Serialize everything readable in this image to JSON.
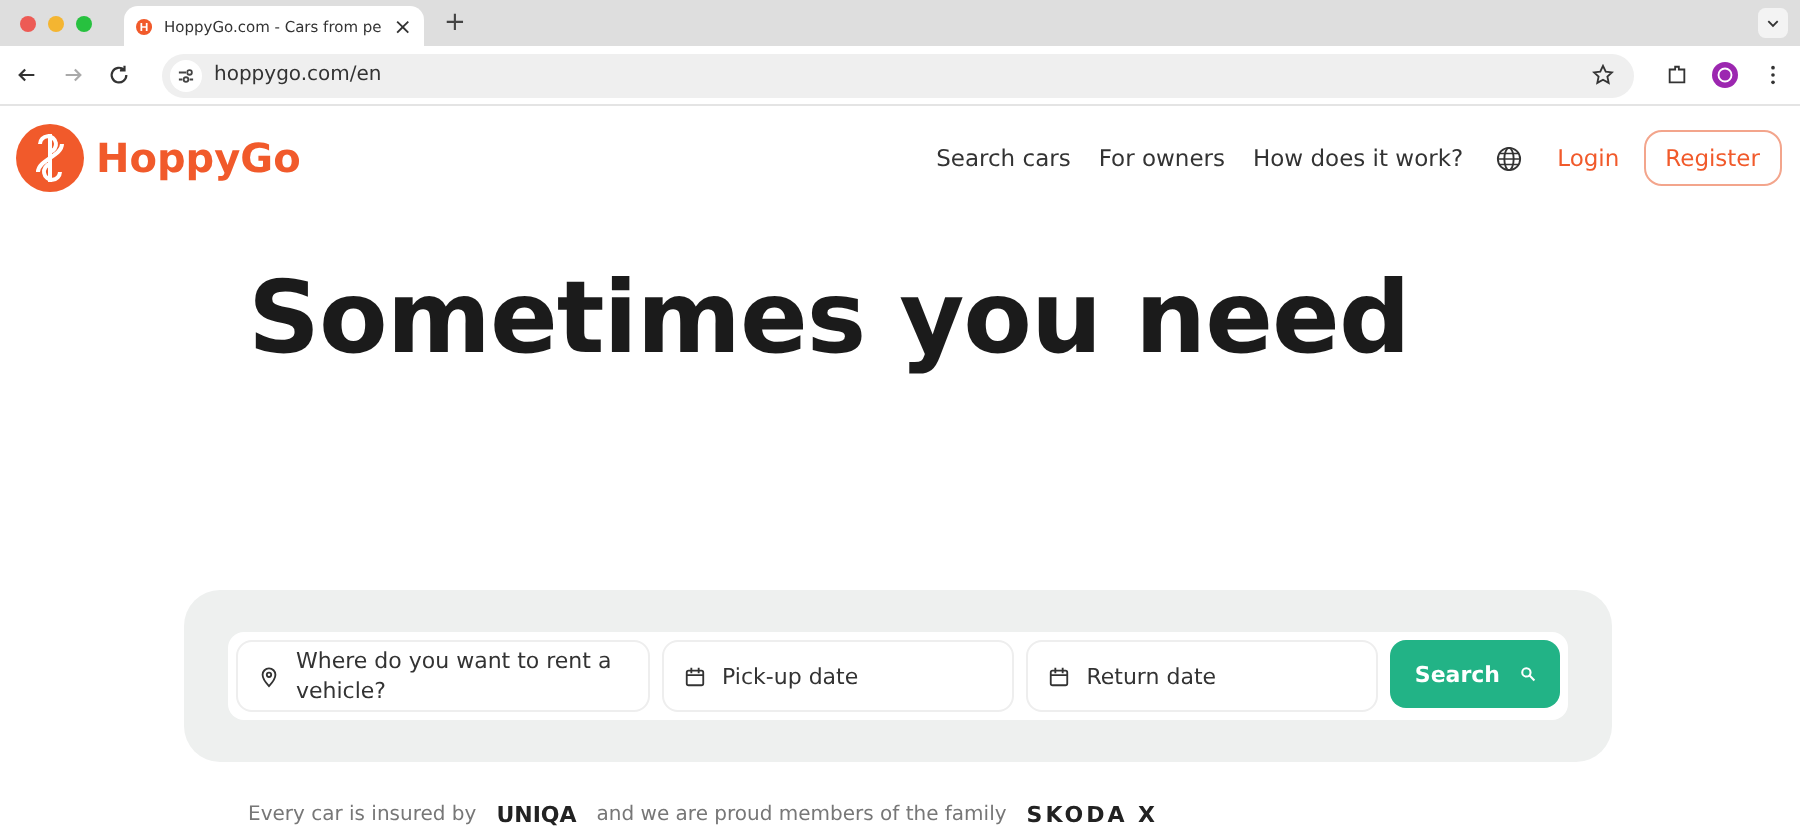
{
  "browser": {
    "tab_title": "HoppyGo.com - Cars from pe",
    "tab_close": "×",
    "new_tab": "+",
    "url": "hoppygo.com/en"
  },
  "nav": {
    "logo": "HoppyGo",
    "links": [
      "Search cars",
      "For owners",
      "How does it work?"
    ],
    "login": "Login",
    "register": "Register"
  },
  "hero": {
    "heading": "Sometimes you need"
  },
  "search": {
    "location": {
      "placeholder": "Where do you want to rent a vehicle?"
    },
    "pickup": {
      "placeholder": "Pick-up date"
    },
    "return": {
      "placeholder": "Return date"
    },
    "button": "Search"
  },
  "footer": {
    "insured_text": "Every car is insured by",
    "insurer_logo": "UNIQA",
    "family_text": "and we are proud members of the family",
    "family_logo": "SKODA X"
  }
}
